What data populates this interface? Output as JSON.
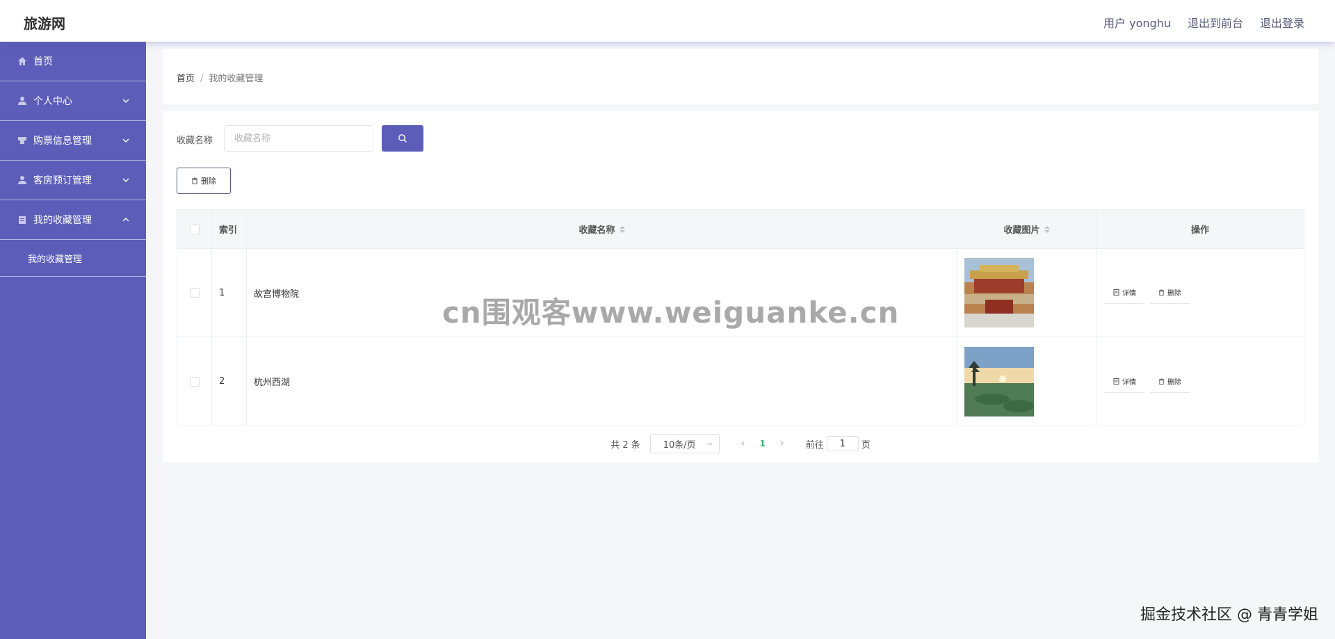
{
  "app": {
    "title": "旅游网"
  },
  "topnav": {
    "user": "用户 yonghu",
    "to_front": "退出到前台",
    "logout": "退出登录"
  },
  "sidebar": {
    "items": [
      {
        "label": "首页",
        "icon": "home-icon"
      },
      {
        "label": "个人中心",
        "icon": "user-icon",
        "expanded": false
      },
      {
        "label": "购票信息管理",
        "icon": "ticket-icon",
        "expanded": false
      },
      {
        "label": "客房预订管理",
        "icon": "user-icon",
        "expanded": false
      },
      {
        "label": "我的收藏管理",
        "icon": "clipboard-icon",
        "expanded": true
      }
    ],
    "sub_item": "我的收藏管理"
  },
  "breadcrumb": {
    "home": "首页",
    "sep": "/",
    "current": "我的收藏管理"
  },
  "search": {
    "label": "收藏名称",
    "placeholder": "收藏名称",
    "value": ""
  },
  "toolbar": {
    "delete_label": "删除"
  },
  "table": {
    "headers": {
      "index": "索引",
      "name": "收藏名称",
      "image": "收藏图片",
      "actions": "操作"
    },
    "rows": [
      {
        "index": "1",
        "name": "故宫博物院",
        "image": "forbidden-city-photo",
        "detail": "详情",
        "delete": "删除"
      },
      {
        "index": "2",
        "name": "杭州西湖",
        "image": "west-lake-photo",
        "detail": "详情",
        "delete": "删除"
      }
    ]
  },
  "pagination": {
    "total": "共 2 条",
    "page_size": "10条/页",
    "current_page": "1",
    "goto_prefix": "前往",
    "goto_value": "1",
    "goto_suffix": "页"
  },
  "watermarks": {
    "center": "cn围观客www.weiguanke.cn",
    "corner": "掘金技术社区 @ 青青学姐"
  },
  "colors": {
    "primary": "#5b5db8",
    "page_active": "#3cb371"
  }
}
